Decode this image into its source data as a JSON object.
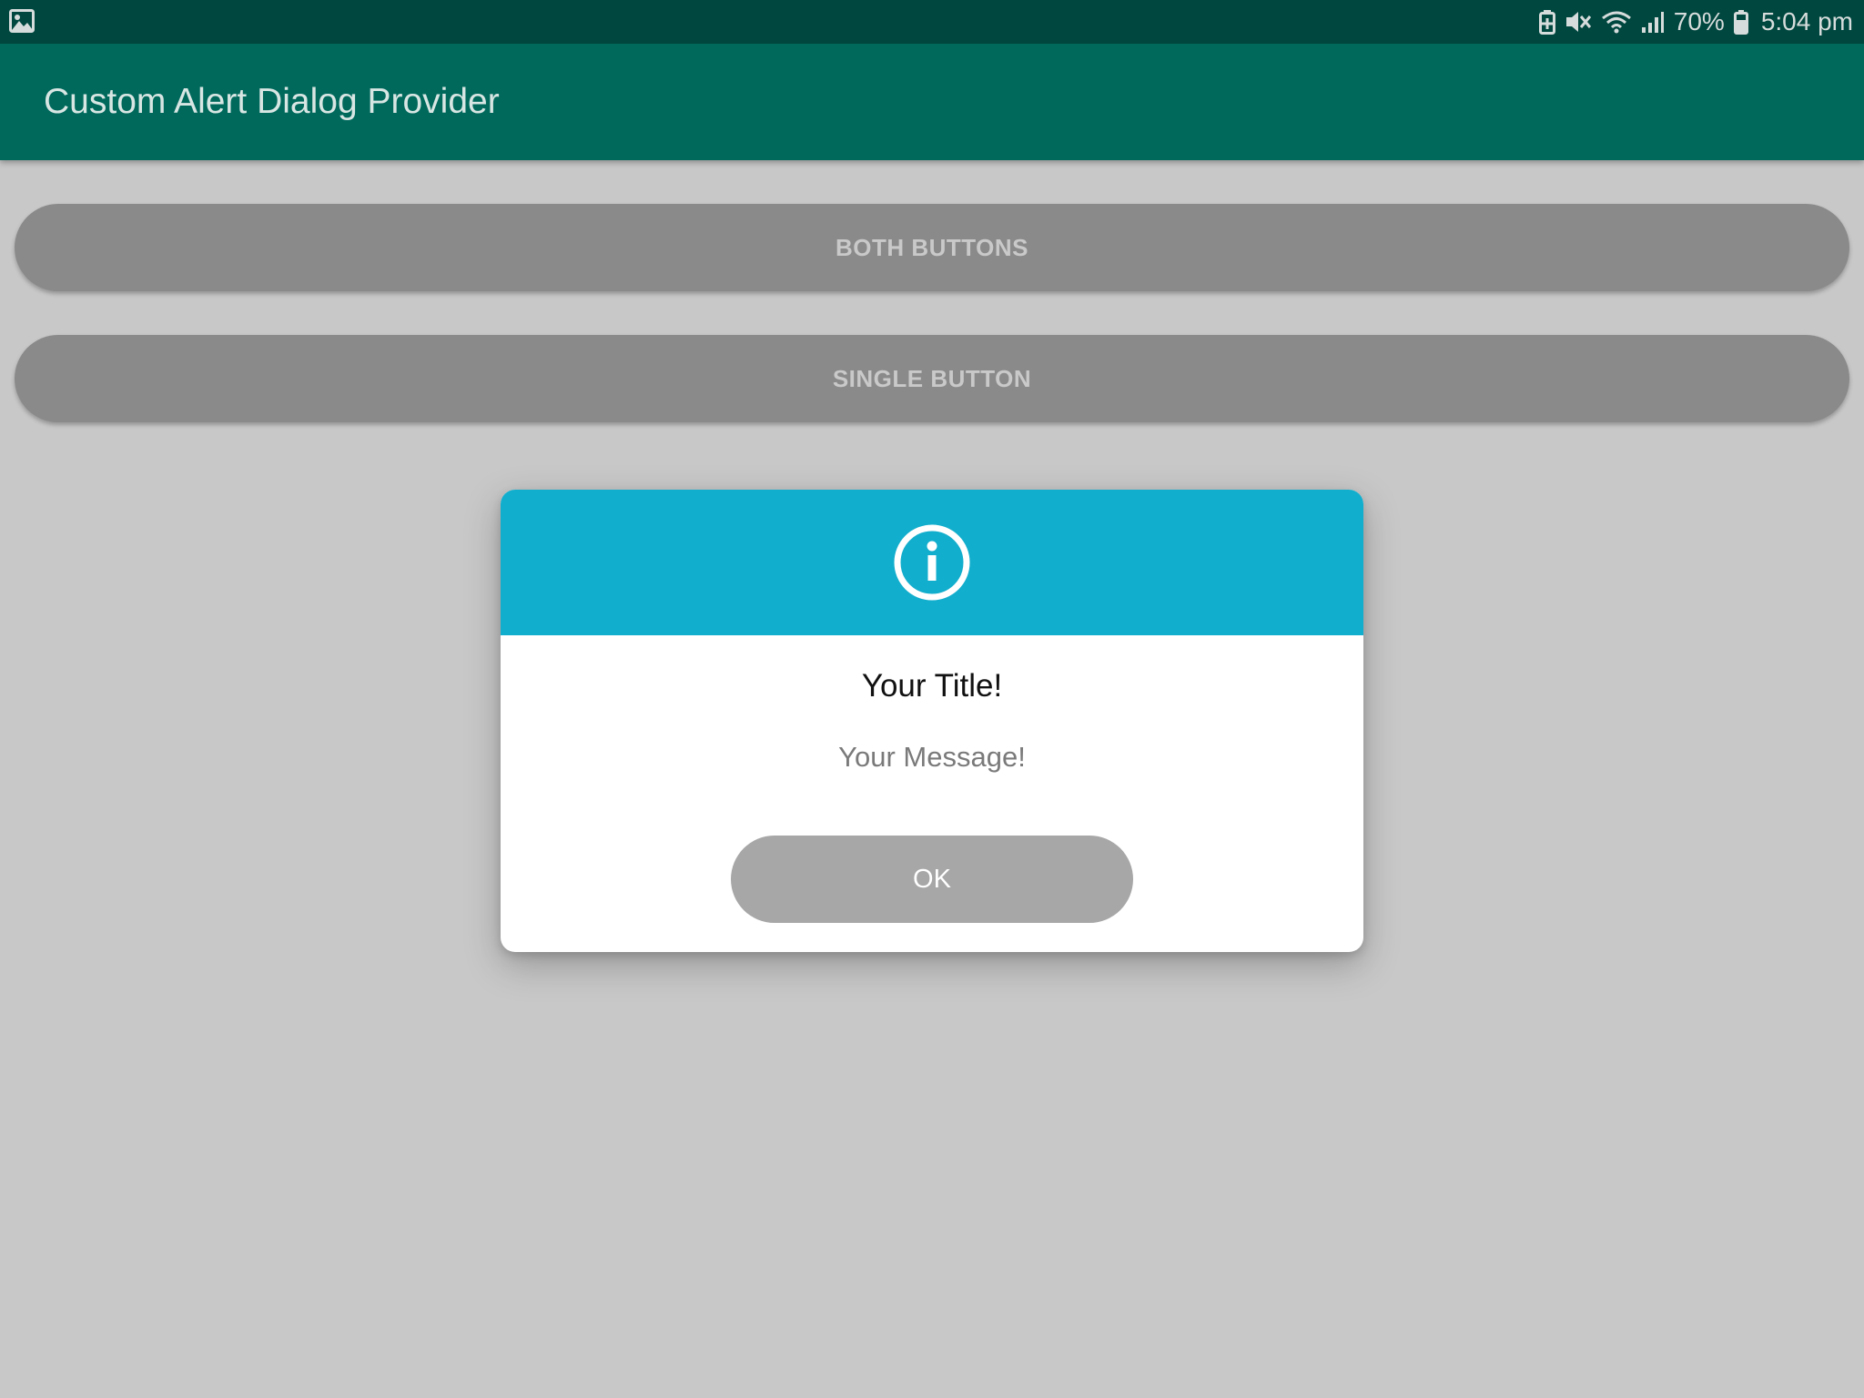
{
  "status_bar": {
    "left_icons": [
      "gallery-icon"
    ],
    "right_icons": [
      "battery-saver-icon",
      "mute-icon",
      "wifi-icon",
      "signal-icon",
      "battery-icon"
    ],
    "battery_percent": "70%",
    "time": "5:04 pm"
  },
  "app_bar": {
    "title": "Custom Alert Dialog Provider"
  },
  "buttons": {
    "both_label": "BOTH BUTTONS",
    "single_label": "SINGLE BUTTON"
  },
  "dialog": {
    "header_icon": "info-icon",
    "title": "Your Title!",
    "message": "Your Message!",
    "ok_label": "OK"
  },
  "colors": {
    "status_bar_bg": "#00473f",
    "app_bar_bg": "#00695c",
    "page_bg": "#c8c8c8",
    "pill_button_bg": "#8a8a8a",
    "dialog_header_bg": "#12aecd",
    "ok_button_bg": "#a7a7a7"
  }
}
